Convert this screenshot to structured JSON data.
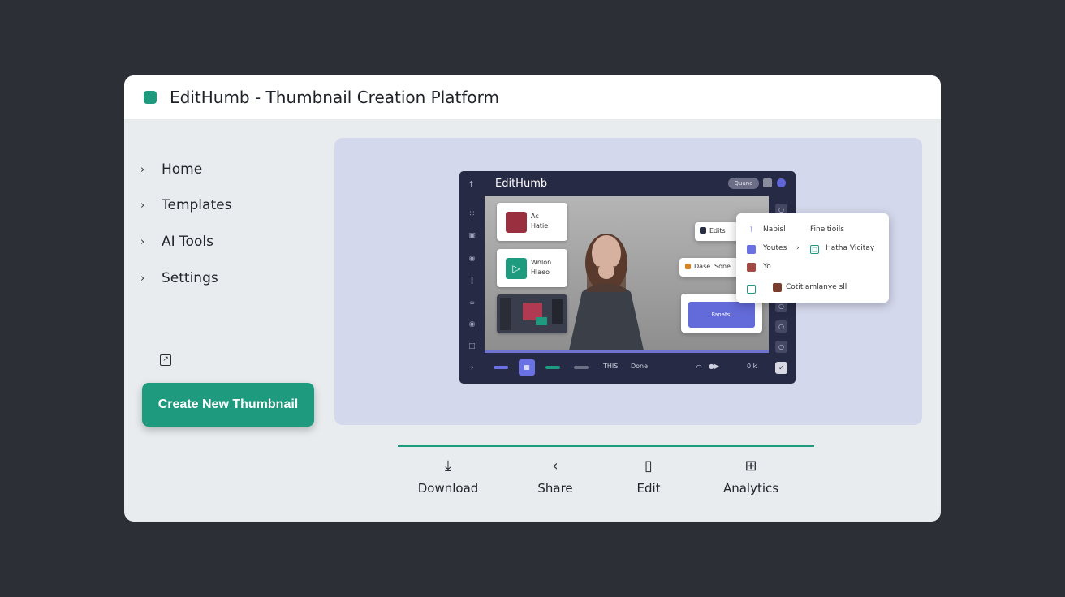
{
  "window": {
    "title": "EditHumb - Thumbnail Creation Platform",
    "accent": "#1e9a7e"
  },
  "sidebar": {
    "items": [
      {
        "label": "Home"
      },
      {
        "label": "Templates"
      },
      {
        "label": "AI Tools"
      },
      {
        "label": "Settings"
      }
    ],
    "create_button": "Create New Thumbnail"
  },
  "editor": {
    "title": "EditHumb",
    "top_pill": "Quana",
    "cards": [
      {
        "line1": "Ac",
        "line2": "Hatie"
      },
      {
        "line1": "Wnlon",
        "line2": "Hlaeo"
      }
    ],
    "popups": {
      "edits": "Edits",
      "done_label": "Dase",
      "sone_label": "Sone",
      "button": "Fanatsl"
    },
    "bottom": {
      "text1": "THIS",
      "text2": "Done",
      "text3": "0 k"
    }
  },
  "context_menu": {
    "row1_a": "Nabisl",
    "row1_b": "Fineitioils",
    "row2_a": "Youtes",
    "row2_b": "Hatha Vicitay",
    "row3_a": "Yo",
    "row4_b": "Cotitlamlanye sll"
  },
  "actions": [
    {
      "label": "Download",
      "icon": "download-icon"
    },
    {
      "label": "Share",
      "icon": "share-icon"
    },
    {
      "label": "Edit",
      "icon": "edit-icon"
    },
    {
      "label": "Analytics",
      "icon": "analytics-icon"
    }
  ]
}
